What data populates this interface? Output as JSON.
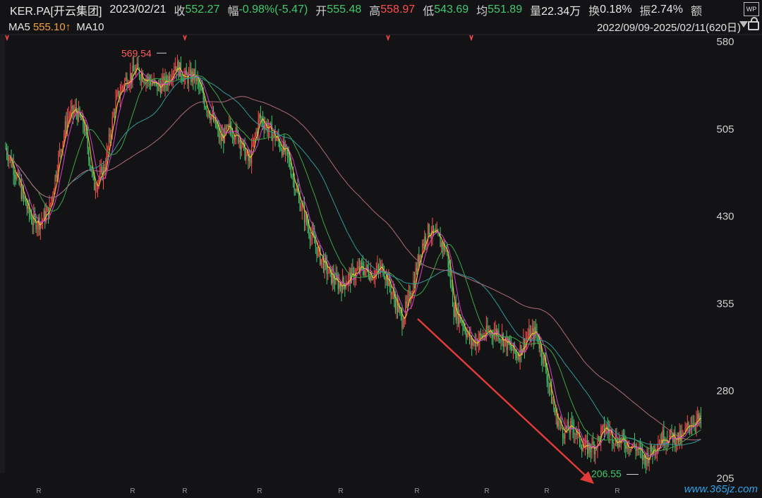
{
  "header": {
    "symbol": "KER.PA[开云集团]",
    "date": "2023/02/21",
    "close_label": "收",
    "close": "552.27",
    "change_label": "幅",
    "change": "-0.98%(-5.47)",
    "open_label": "开",
    "open": "555.48",
    "high_label": "高",
    "high": "558.97",
    "low_label": "低",
    "low": "543.69",
    "avg_label": "均",
    "avg": "551.89",
    "volume_label": "量",
    "volume": "22.34万",
    "turnover_label": "换",
    "turnover": "0.18%",
    "amplitude_label": "振",
    "amplitude": "2.74%",
    "amount_label": "额"
  },
  "ma_bar": {
    "ma5_label": "MA5",
    "ma5_value": "555.10↑",
    "ma10_label": "MA10",
    "range": "2022/09/09-2025/02/11(620日)"
  },
  "icons": {
    "wp": "WP",
    "lock": "lock-icon"
  },
  "watermark": "www.365jz.com",
  "colors": {
    "background": "#131316",
    "up": "#ff4d4f",
    "down": "#41c96d",
    "ma_fast": "#f2c037",
    "ma_mid": "#d63fd1",
    "ma_green": "#3aa845",
    "ma_teal": "#2f9a9a",
    "ma_long": "#b06a7a",
    "arrow": "#e03a3a"
  },
  "chart_data": {
    "type": "candlestick",
    "x_range": [
      "2022/09/09",
      "2025/02/11"
    ],
    "ylim": [
      205,
      580
    ],
    "yticks": [
      580,
      505,
      430,
      355,
      280,
      205
    ],
    "annotations": [
      {
        "label": "569.54",
        "value": 569.54,
        "kind": "high"
      },
      {
        "label": "206.55",
        "value": 206.55,
        "kind": "low"
      }
    ],
    "x_markers": [
      "R",
      "R",
      "R",
      "R",
      "R",
      "R",
      "R",
      "R",
      "R"
    ],
    "price_path": [
      [
        0,
        488
      ],
      [
        12,
        470
      ],
      [
        25,
        445
      ],
      [
        38,
        425
      ],
      [
        50,
        425
      ],
      [
        62,
        435
      ],
      [
        75,
        480
      ],
      [
        88,
        515
      ],
      [
        100,
        520
      ],
      [
        112,
        505
      ],
      [
        125,
        455
      ],
      [
        140,
        470
      ],
      [
        155,
        525
      ],
      [
        168,
        545
      ],
      [
        185,
        555
      ],
      [
        200,
        548
      ],
      [
        215,
        540
      ],
      [
        228,
        545
      ],
      [
        240,
        560
      ],
      [
        255,
        548
      ],
      [
        268,
        550
      ],
      [
        280,
        530
      ],
      [
        292,
        515
      ],
      [
        305,
        495
      ],
      [
        318,
        505
      ],
      [
        330,
        498
      ],
      [
        345,
        475
      ],
      [
        360,
        515
      ],
      [
        372,
        505
      ],
      [
        385,
        495
      ],
      [
        400,
        480
      ],
      [
        415,
        445
      ],
      [
        430,
        418
      ],
      [
        445,
        395
      ],
      [
        460,
        378
      ],
      [
        475,
        370
      ],
      [
        490,
        378
      ],
      [
        505,
        385
      ],
      [
        520,
        380
      ],
      [
        535,
        385
      ],
      [
        550,
        360
      ],
      [
        562,
        340
      ],
      [
        575,
        365
      ],
      [
        590,
        405
      ],
      [
        600,
        418
      ],
      [
        612,
        410
      ],
      [
        625,
        400
      ],
      [
        635,
        350
      ],
      [
        648,
        338
      ],
      [
        660,
        320
      ],
      [
        672,
        325
      ],
      [
        685,
        330
      ],
      [
        698,
        330
      ],
      [
        710,
        320
      ],
      [
        725,
        310
      ],
      [
        738,
        325
      ],
      [
        752,
        330
      ],
      [
        765,
        300
      ],
      [
        778,
        260
      ],
      [
        790,
        245
      ],
      [
        805,
        248
      ],
      [
        820,
        230
      ],
      [
        835,
        232
      ],
      [
        850,
        248
      ],
      [
        865,
        238
      ],
      [
        880,
        235
      ],
      [
        895,
        230
      ],
      [
        905,
        220
      ],
      [
        918,
        230
      ],
      [
        930,
        240
      ],
      [
        945,
        240
      ],
      [
        958,
        238
      ],
      [
        970,
        252
      ],
      [
        980,
        255
      ],
      [
        990,
        248
      ]
    ],
    "series": [
      {
        "name": "MA5",
        "role": "ma_fast"
      },
      {
        "name": "MA10",
        "role": "ma_mid"
      }
    ]
  }
}
